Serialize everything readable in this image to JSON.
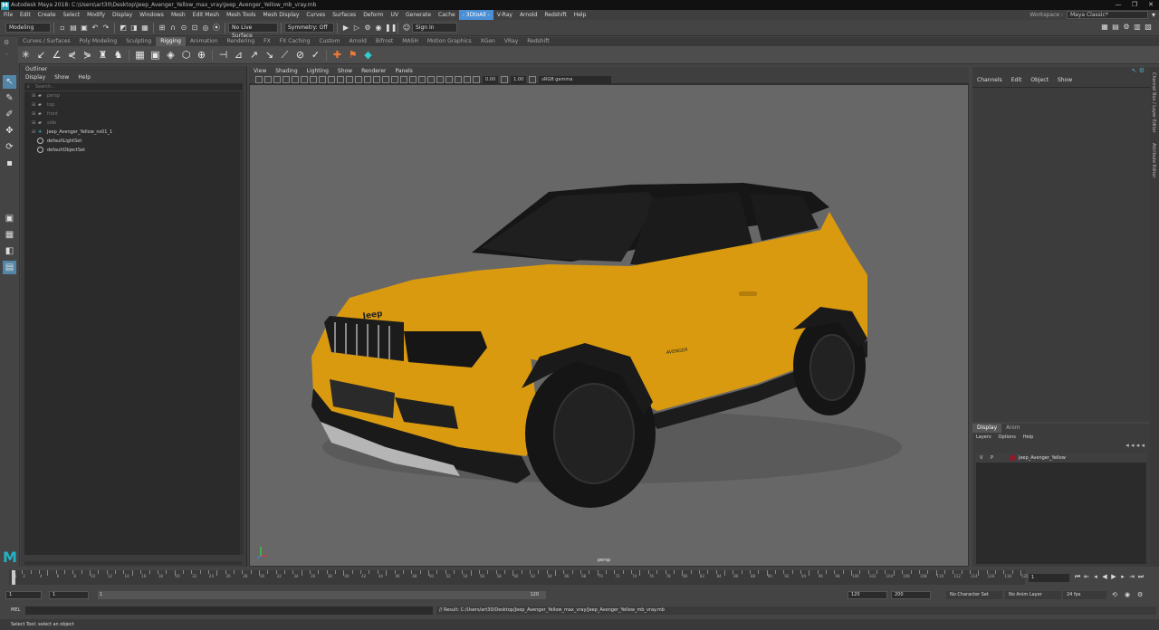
{
  "titlebar": {
    "title": "Autodesk Maya 2018: C:\\Users\\art30\\Desktop\\Jeep_Avenger_Yellow_max_vray\\Jeep_Avenger_Yellow_mb_vray.mb",
    "logo": "M",
    "minimize": "—",
    "maximize": "❐",
    "close": "✕"
  },
  "menubar": {
    "items": [
      "File",
      "Edit",
      "Create",
      "Select",
      "Modify",
      "Display",
      "Windows",
      "Mesh",
      "Edit Mesh",
      "Mesh Tools",
      "Mesh Display",
      "Curves",
      "Surfaces",
      "Deform",
      "UV",
      "Generate",
      "Cache",
      "- 3DtoAll -",
      "V-Ray",
      "Arnold",
      "Redshift",
      "Help"
    ],
    "highlighted_index": 17,
    "workspace_label": "Workspace :",
    "workspace_value": "Maya Classic*"
  },
  "statusline": {
    "mode": "Modeling",
    "live_surface": "No Live Surface",
    "symmetry": "Symmetry: Off",
    "sign_in": "Sign In"
  },
  "shelf": {
    "tabs": [
      "Curves / Surfaces",
      "Poly Modeling",
      "Sculpting",
      "Rigging",
      "Animation",
      "Rendering",
      "FX",
      "FX Caching",
      "Custom",
      "Arnold",
      "Bifrost",
      "MASH",
      "Motion Graphics",
      "XGen",
      "VRay",
      "Redshift"
    ],
    "active_tab": "Rigging"
  },
  "outliner": {
    "title": "Outliner",
    "menus": [
      "Display",
      "Show",
      "Help"
    ],
    "search_placeholder": "Search...",
    "items": [
      {
        "label": "persp",
        "dim": true,
        "type": "camera"
      },
      {
        "label": "top",
        "dim": true,
        "type": "camera"
      },
      {
        "label": "front",
        "dim": true,
        "type": "camera"
      },
      {
        "label": "side",
        "dim": true,
        "type": "camera"
      },
      {
        "label": "Jeep_Avenger_Yellow_ns01_1",
        "dim": false,
        "type": "group"
      },
      {
        "label": "defaultLightSet",
        "dim": false,
        "type": "set"
      },
      {
        "label": "defaultObjectSet",
        "dim": false,
        "type": "set"
      }
    ]
  },
  "viewport": {
    "menus": [
      "View",
      "Shading",
      "Lighting",
      "Show",
      "Renderer",
      "Panels"
    ],
    "exposure": "0.00",
    "gamma": "1.00",
    "colorspace": "sRGB gamma",
    "camera": "persp",
    "brand_text": "Jeep",
    "badge_text": "AVENGER",
    "body_color": "#d99a10",
    "roof_color": "#161616",
    "background_color": "#676767"
  },
  "channelbox": {
    "menus": [
      "Channels",
      "Edit",
      "Object",
      "Show"
    ],
    "side_tabs": [
      "Channel Box / Layer Editor",
      "Attribute Editor"
    ]
  },
  "layers": {
    "tabs": [
      "Display",
      "Anim"
    ],
    "active_tab": "Display",
    "menus": [
      "Layers",
      "Options",
      "Help"
    ],
    "rows": [
      {
        "v": "V",
        "p": "P",
        "name": "Jeep_Avenger_Yellow",
        "color": "#8b1a2a"
      }
    ]
  },
  "timeslider": {
    "tick_labels": [
      "1",
      "2",
      "4",
      "6",
      "8",
      "10",
      "12",
      "14",
      "16",
      "18",
      "20",
      "22",
      "24",
      "26",
      "28",
      "30",
      "32",
      "34",
      "36",
      "38",
      "40",
      "42",
      "44",
      "46",
      "48",
      "50",
      "52",
      "54",
      "56",
      "58",
      "60",
      "62",
      "64",
      "66",
      "68",
      "70",
      "72",
      "74",
      "76",
      "78",
      "80",
      "82",
      "84",
      "86",
      "88",
      "90",
      "92",
      "94",
      "96",
      "98",
      "100",
      "102",
      "104",
      "106",
      "108",
      "110",
      "112",
      "114",
      "116",
      "118",
      "120"
    ],
    "current_frame": "1"
  },
  "rangeslider": {
    "start": "1",
    "start2": "1",
    "range_start": "1",
    "range_end": "120",
    "end": "120",
    "end2": "200",
    "character_set": "No Character Set",
    "anim_layer": "No Anim Layer",
    "fps": "24 fps"
  },
  "cmdline": {
    "label": "MEL",
    "result": "// Result: C:/Users/art30/Desktop/Jeep_Avenger_Yellow_max_vray/Jeep_Avenger_Yellow_mb_vray.mb"
  },
  "helpline": {
    "text": "Select Tool: select an object"
  }
}
